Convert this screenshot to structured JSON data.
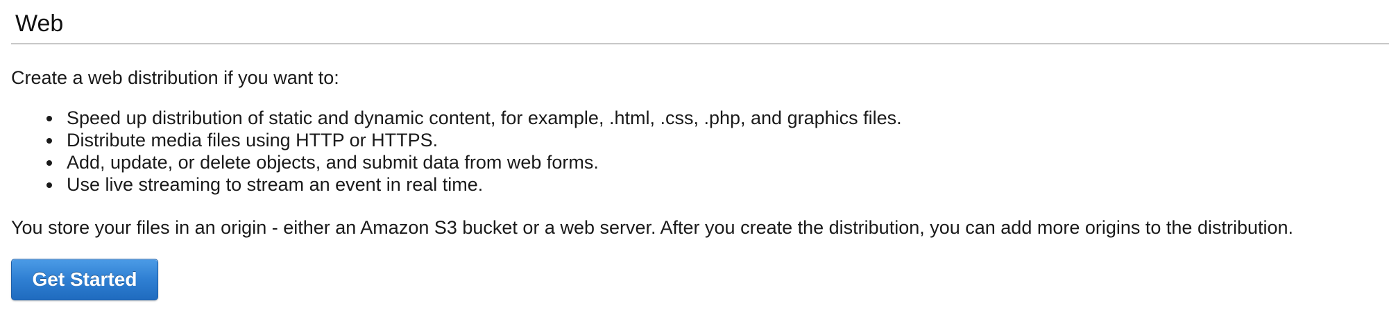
{
  "section": {
    "title": "Web"
  },
  "intro_text": "Create a web distribution if you want to:",
  "bullets": [
    "Speed up distribution of static and dynamic content, for example, .html, .css, .php, and graphics files.",
    "Distribute media files using HTTP or HTTPS.",
    "Add, update, or delete objects, and submit data from web forms.",
    "Use live streaming to stream an event in real time."
  ],
  "footnote_text": "You store your files in an origin - either an Amazon S3 bucket or a web server. After you create the distribution, you can add more origins to the distribution.",
  "actions": {
    "get_started_label": "Get Started"
  },
  "colors": {
    "button_primary": "#2f7fd2",
    "button_border": "#1e5fa8",
    "divider": "#c8c8c8"
  }
}
